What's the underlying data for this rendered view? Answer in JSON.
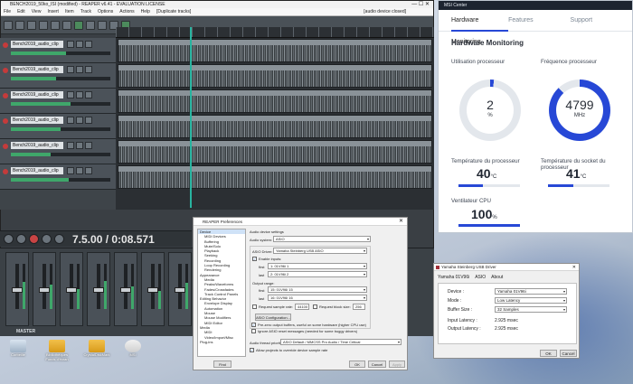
{
  "reaper": {
    "title": "BENCH2019_50ko_ISI (modified) - REAPER v6.41 - EVALUATION LICENSE",
    "menu": [
      "File",
      "Edit",
      "View",
      "Insert",
      "Item",
      "Track",
      "Options",
      "Actions",
      "Help",
      "[Duplicate tracks]"
    ],
    "menu_right": "[audio device closed]",
    "tracks": [
      {
        "name": "Bench2019_audio_clip",
        "meter": 0.55
      },
      {
        "name": "Bench2019_audio_clip",
        "meter": 0.45
      },
      {
        "name": "Bench2019_audio_clip",
        "meter": 0.6
      },
      {
        "name": "Bench2019_audio_clip",
        "meter": 0.5
      },
      {
        "name": "Bench2019_audio_clip",
        "meter": 0.4
      },
      {
        "name": "Bench2019_audio_clip",
        "meter": 0.58
      }
    ],
    "timecode": "7.5.00 / 0:08.571",
    "master_label": "MASTER",
    "mixer_strip_label": "bch2019_au"
  },
  "desktop_icons": [
    {
      "label": "Corbeille"
    },
    {
      "label": "Bibliothèques Fonds d'écran"
    },
    {
      "label": "CrystalDiskMark"
    },
    {
      "label": "REAPER_Cache"
    },
    {
      "label": "MSI"
    }
  ],
  "msi": {
    "window_title": "MSI Center",
    "tabs": [
      "Hardware Monitoring",
      "Features",
      "Support"
    ],
    "heading": "Hardware Monitoring",
    "cpu_usage_label": "Utilisation processeur",
    "cpu_freq_label": "Fréquence processeur",
    "cpu_usage_value": "2",
    "cpu_usage_unit": "%",
    "cpu_usage_fraction": 0.02,
    "cpu_freq_value": "4799",
    "cpu_freq_unit": "MHz",
    "cpu_freq_fraction": 0.88,
    "cpu_temp_label": "Température du processeur",
    "cpu_temp_value": "40",
    "cpu_temp_unit": "°C",
    "cpu_temp_fraction": 0.4,
    "socket_temp_label": "Température du socket du processeur",
    "socket_temp_value": "41",
    "socket_temp_unit": "°C",
    "socket_temp_fraction": 0.41,
    "fan_label": "Ventilateur CPU",
    "fan_value": "100",
    "fan_unit": "%",
    "fan_fraction": 1.0,
    "accent": "#2748d6"
  },
  "prefs": {
    "title": "REAPER Preferences",
    "tree": [
      {
        "label": "Device",
        "level": 1,
        "selected": true
      },
      {
        "label": "MIDI Devices",
        "level": 2
      },
      {
        "label": "Buffering",
        "level": 2
      },
      {
        "label": "Mute/Solo",
        "level": 2
      },
      {
        "label": "Playback",
        "level": 2
      },
      {
        "label": "Seeking",
        "level": 2
      },
      {
        "label": "Recording",
        "level": 2
      },
      {
        "label": "Loop Recording",
        "level": 2
      },
      {
        "label": "Rendering",
        "level": 2
      },
      {
        "label": "Appearance",
        "level": 1
      },
      {
        "label": "Media",
        "level": 2
      },
      {
        "label": "Peaks/Waveforms",
        "level": 2
      },
      {
        "label": "Fades/Crossfades",
        "level": 2
      },
      {
        "label": "Track Control Panels",
        "level": 2
      },
      {
        "label": "Editing Behavior",
        "level": 1
      },
      {
        "label": "Envelope Display",
        "level": 2
      },
      {
        "label": "Automation",
        "level": 2
      },
      {
        "label": "Mouse",
        "level": 2
      },
      {
        "label": "Mouse Modifiers",
        "level": 2
      },
      {
        "label": "MIDI Editor",
        "level": 2
      },
      {
        "label": "Media",
        "level": 1
      },
      {
        "label": "MIDI",
        "level": 2
      },
      {
        "label": "Video/Import/Misc",
        "level": 2
      },
      {
        "label": "Plug-ins",
        "level": 1
      }
    ],
    "section_title": "Audio device settings",
    "audio_system_label": "Audio system:",
    "audio_system_value": "ASIO",
    "asio_driver_label": "ASIO Driver:",
    "asio_driver_value": "Yamaha Steinberg USB ASIO",
    "enable_inputs_label": "Enable inputs:",
    "input_first_label": "first",
    "input_first_value": "1: 01V96i 1",
    "input_last_label": "last",
    "input_last_value": "2: 01V96i 2",
    "output_range_label": "Output range:",
    "output_first_label": "first",
    "output_first_value": "15: 01V96i 15",
    "output_last_label": "last",
    "output_last_value": "16: 01V96i 16",
    "req_rate_label": "Request sample rate:",
    "req_rate_value": "44100",
    "req_block_label": "Request block size:",
    "req_block_value": "256",
    "asio_config_button": "ASIO Configuration...",
    "prezero_label": "Pre-zero output buffers, useful on some hardware (higher CPU use)",
    "ignore_reset_label": "Ignore ASIO reset messages (needed for some buggy drivers)",
    "thread_priority_label": "Audio thread priority:",
    "thread_priority_value": "ASIO Default / MMCSS Pro Audio / Time Critical",
    "allow_override_label": "Allow projects to override device sample rate",
    "find_button": "Find",
    "ok_button": "OK",
    "cancel_button": "Cancel",
    "apply_button": "Apply"
  },
  "yamaha": {
    "title": "Yamaha Steinberg USB Driver",
    "tabs": [
      "Yamaha 01V96i",
      "ASIO",
      "About"
    ],
    "device_label": "Device :",
    "device_value": "Yamaha 01V96i",
    "mode_label": "Mode :",
    "mode_value": "Low Latency",
    "buffer_label": "Buffer Size :",
    "buffer_value": "32 Samples",
    "input_latency_label": "Input Latency :",
    "input_latency_value": "2.925 msec",
    "output_latency_label": "Output Latency :",
    "output_latency_value": "2.925 msec",
    "ok_button": "OK",
    "cancel_button": "Cancel"
  }
}
